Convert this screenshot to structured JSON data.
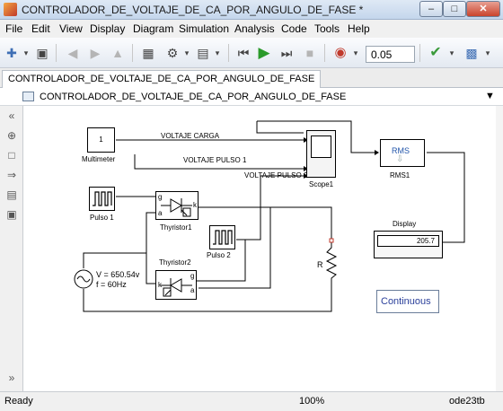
{
  "window": {
    "title": "CONTROLADOR_DE_VOLTAJE_DE_CA_POR_ANGULO_DE_FASE *"
  },
  "menu": [
    "File",
    "Edit",
    "View",
    "Display",
    "Diagram",
    "Simulation",
    "Analysis",
    "Code",
    "Tools",
    "Help"
  ],
  "toolbar": {
    "stop_time": "0.05"
  },
  "tabs": [
    {
      "label": "CONTROLADOR_DE_VOLTAJE_DE_CA_POR_ANGULO_DE_FASE"
    }
  ],
  "breadcrumb": {
    "path": "CONTROLADOR_DE_VOLTAJE_DE_CA_POR_ANGULO_DE_FASE"
  },
  "diagram": {
    "multimeter": {
      "value": "1",
      "label": "Multimeter"
    },
    "pulse1": {
      "label": "Pulso 1"
    },
    "pulse2": {
      "label": "Pulso 2"
    },
    "thyristor1": {
      "label": "Thyristor1"
    },
    "thyristor2": {
      "label": "Thyristor2"
    },
    "scope": {
      "label": "Scope1"
    },
    "rms": {
      "text": "RMS",
      "label": "RMS1"
    },
    "display": {
      "title": "Display",
      "value": "205.7"
    },
    "source": {
      "line1": "V = 650.54v",
      "line2": "f = 60Hz"
    },
    "resistor": {
      "label": "R"
    },
    "powergui": {
      "text": "Continuous"
    },
    "signals": {
      "carga": "VOLTAJE CARGA",
      "pulso1": "VOLTAJE PULSO 1",
      "pulso2": "VOLTAJE PULSO 2"
    },
    "ports": {
      "g": "g",
      "a": "a",
      "k": "k"
    }
  },
  "status": {
    "state": "Ready",
    "zoom": "100%",
    "solver": "ode23tb"
  }
}
